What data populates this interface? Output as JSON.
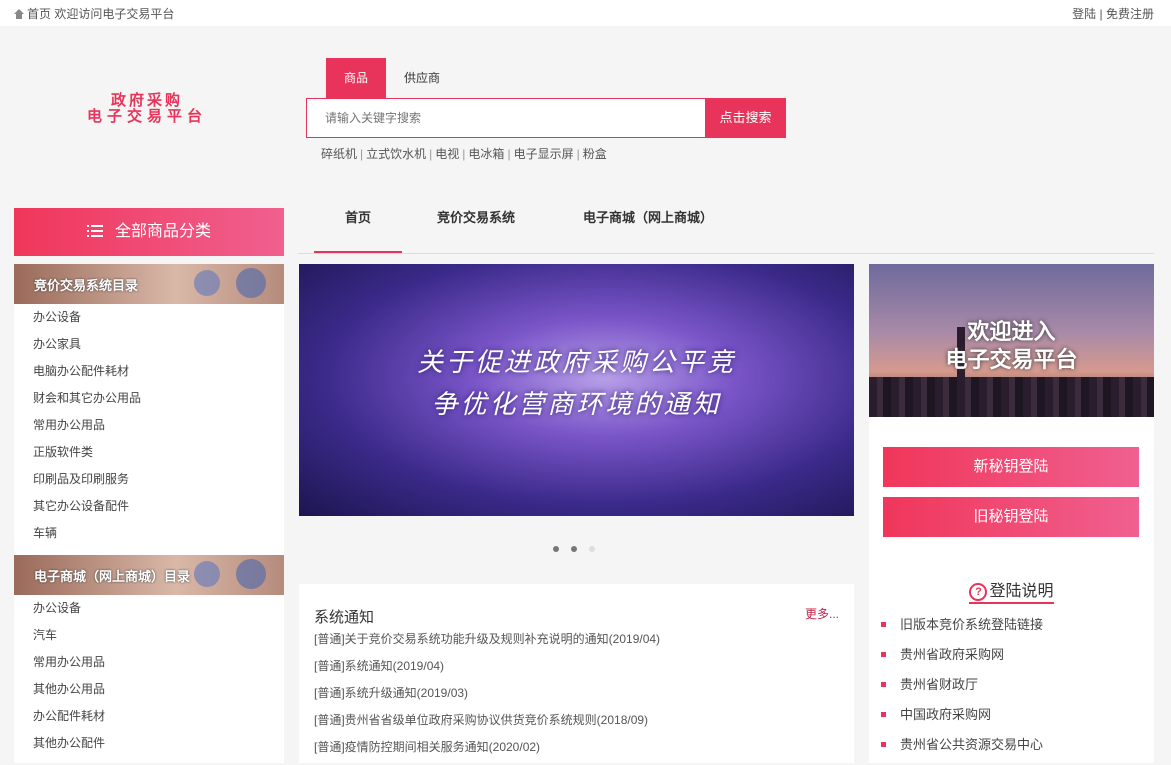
{
  "topbar": {
    "home": "首页",
    "welcome": "欢迎访问电子交易平台",
    "login": "登陆",
    "separator": "|",
    "register": "免费注册"
  },
  "logo": {
    "line1": "政府采购",
    "line2": "电子交易平台"
  },
  "search": {
    "tabs": [
      "商品",
      "供应商"
    ],
    "placeholder": "请输入关键字搜索",
    "button": "点击搜索",
    "hotwords": [
      "碎纸机",
      "立式饮水机",
      "电视",
      "电冰箱",
      "电子显示屏",
      "粉盒"
    ]
  },
  "category": {
    "title": "全部商品分类"
  },
  "sidebar": {
    "section1": {
      "title": "竞价交易系统目录",
      "items": [
        "办公设备",
        "办公家具",
        "电脑办公配件耗材",
        "财会和其它办公用品",
        "常用办公用品",
        "正版软件类",
        "印刷品及印刷服务",
        "其它办公设备配件",
        "车辆"
      ]
    },
    "section2": {
      "title": "电子商城（网上商城）目录",
      "items": [
        "办公设备",
        "汽车",
        "常用办公用品",
        "其他办公用品",
        "办公配件耗材",
        "其他办公配件"
      ]
    }
  },
  "nav": {
    "items": [
      "首页",
      "竞价交易系统",
      "电子商城（网上商城）"
    ]
  },
  "carousel": {
    "line1": "关于促进政府采购公平竞",
    "line2": "争优化营商环境的通知",
    "dots": 3,
    "active_dot": 1
  },
  "notice": {
    "title": "系统通知",
    "more": "更多...",
    "items": [
      "[普通]关于竞价交易系统功能升级及规则补充说明的通知(2019/04)",
      "[普通]系统通知(2019/04)",
      "[普通]系统升级通知(2019/03)",
      "[普通]贵州省省级单位政府采购协议供货竞价系统规则(2018/09)",
      "[普通]疫情防控期间相关服务通知(2020/02)"
    ]
  },
  "right": {
    "banner_line1": "欢迎进入",
    "banner_line2": "电子交易平台",
    "login_new": "新秘钥登陆",
    "login_old": "旧秘钥登陆",
    "help_title": "登陆说明",
    "links": [
      "旧版本竞价系统登陆链接",
      "贵州省政府采购网",
      "贵州省财政厅",
      "中国政府采购网",
      "贵州省公共资源交易中心"
    ]
  },
  "colors": {
    "accent": "#e8345a"
  }
}
